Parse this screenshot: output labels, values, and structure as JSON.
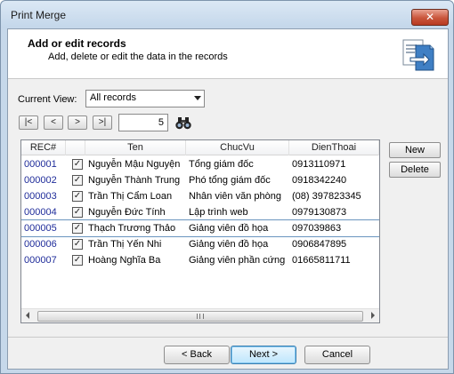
{
  "window": {
    "title": "Print Merge",
    "close_glyph": "✕"
  },
  "header": {
    "title": "Add or edit records",
    "subtitle": "Add, delete or edit the data in the records",
    "icon": "merge-document-icon"
  },
  "view": {
    "label": "Current View:",
    "selected": "All records"
  },
  "navigation": {
    "first": "|<",
    "prev": "<",
    "next": ">",
    "last": ">|",
    "record_number": "5",
    "find_icon": "binoculars-icon"
  },
  "grid": {
    "columns": [
      "REC#",
      "Ten",
      "ChucVu",
      "DienThoai"
    ],
    "rows": [
      {
        "rec": "000001",
        "checked": true,
        "ten": "Nguyễn Mậu Nguyện",
        "chucvu": "Tổng giám đốc",
        "dienthoai": "0913110971"
      },
      {
        "rec": "000002",
        "checked": true,
        "ten": "Nguyễn Thành Trung",
        "chucvu": "Phó tổng giám đốc",
        "dienthoai": "0918342240"
      },
      {
        "rec": "000003",
        "checked": true,
        "ten": "Trần Thị Cẩm Loan",
        "chucvu": "Nhân viên văn phòng",
        "dienthoai": "(08) 397823345"
      },
      {
        "rec": "000004",
        "checked": true,
        "ten": "Nguyễn Đức Tính",
        "chucvu": "Lập trình web",
        "dienthoai": "0979130873"
      },
      {
        "rec": "000005",
        "checked": true,
        "ten": "Thạch Trương Thảo",
        "chucvu": "Giảng viên đồ họa",
        "dienthoai": "097039863"
      },
      {
        "rec": "000006",
        "checked": true,
        "ten": "Trần Thị Yến Nhi",
        "chucvu": "Giảng viên đồ họa",
        "dienthoai": "0906847895"
      },
      {
        "rec": "000007",
        "checked": true,
        "ten": "Hoàng Nghĩa Ba",
        "chucvu": "Giảng viên phần cứng",
        "dienthoai": "01665811711"
      }
    ],
    "selected_index": 4,
    "check_glyph": "✓"
  },
  "side_buttons": {
    "new": "New",
    "delete": "Delete"
  },
  "footer": {
    "back": "< Back",
    "next": "Next >",
    "cancel": "Cancel"
  }
}
